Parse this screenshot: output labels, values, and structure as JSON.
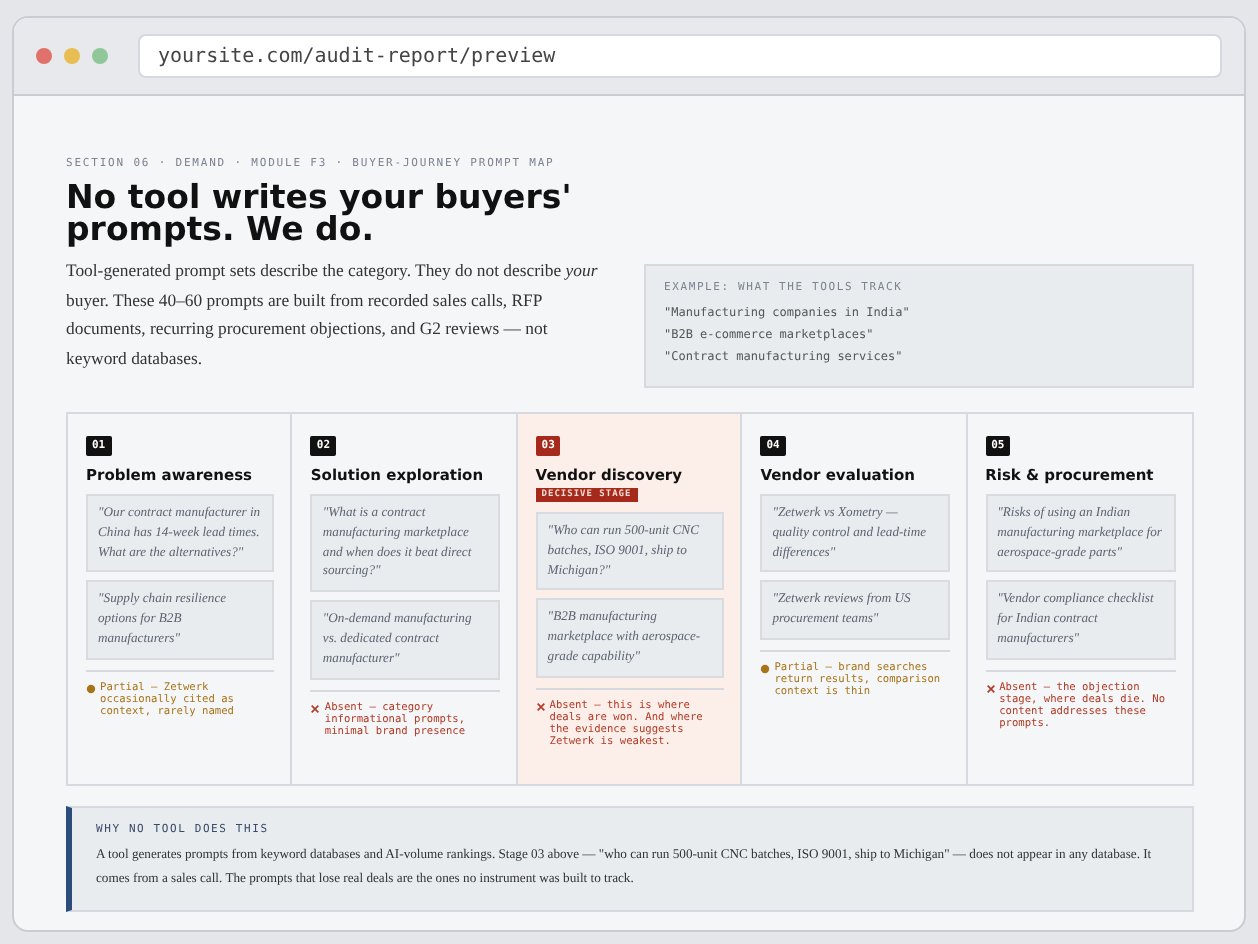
{
  "browser": {
    "url": "yoursite.com/audit-report/preview"
  },
  "eyebrow": "SECTION 06 · DEMAND · MODULE F3 · BUYER-JOURNEY PROMPT MAP",
  "headline": "No tool writes your buyers' prompts. We do.",
  "intro": "Tool-generated prompt sets describe the category. They do not describe *your* buyer. These 40–60 prompts are built from recorded sales calls, RFP documents, recurring procurement objections, and G2 reviews — not keyword databases.",
  "example": {
    "label": "EXAMPLE: WHAT THE TOOLS TRACK",
    "items": [
      "\"Manufacturing companies in India\"",
      "\"B2B e-commerce marketplaces\"",
      "\"Contract manufacturing services\""
    ]
  },
  "stages": [
    {
      "number": "01",
      "title": "Problem awareness",
      "highlighted": false,
      "prompts": [
        "\"Our contract manufacturer in China has 14-week lead times. What are the alternatives?\"",
        "\"Supply chain resilience options for B2B manufacturers\""
      ],
      "status": {
        "kind": "partial",
        "text": "Partial — Zetwerk occasionally cited as context, rarely named"
      }
    },
    {
      "number": "02",
      "title": "Solution exploration",
      "highlighted": false,
      "prompts": [
        "\"What is a contract manufacturing marketplace and when does it beat direct sourcing?\"",
        "\"On-demand manufacturing vs. dedicated contract manufacturer\""
      ],
      "status": {
        "kind": "absent",
        "text": "Absent — category informational prompts, minimal brand presence"
      }
    },
    {
      "number": "03",
      "title": "Vendor discovery",
      "highlighted": true,
      "badge": "DECISIVE STAGE",
      "prompts": [
        "\"Who can run 500-unit CNC batches, ISO 9001, ship to Michigan?\"",
        "\"B2B manufacturing marketplace with aerospace-grade capability\""
      ],
      "status": {
        "kind": "absent",
        "text": "Absent — this is where deals are won. And where the evidence suggests Zetwerk is weakest."
      }
    },
    {
      "number": "04",
      "title": "Vendor evaluation",
      "highlighted": false,
      "prompts": [
        "\"Zetwerk vs Xometry — quality control and lead-time differences\"",
        "\"Zetwerk reviews from US procurement teams\""
      ],
      "status": {
        "kind": "partial",
        "text": "Partial — brand searches return results, comparison context is thin"
      }
    },
    {
      "number": "05",
      "title": "Risk & procurement",
      "highlighted": false,
      "prompts": [
        "\"Risks of using an Indian manufacturing marketplace for aerospace-grade parts\"",
        "\"Vendor compliance checklist for Indian contract manufacturers\""
      ],
      "status": {
        "kind": "absent",
        "text": "Absent — the objection stage, where deals die. No content addresses these prompts."
      }
    }
  ],
  "note": {
    "label": "WHY NO TOOL DOES THIS",
    "text": "A tool generates prompts from keyword databases and AI-volume rankings. Stage 03 above — \"who can run 500-unit CNC batches, ISO 9001, ship to Michigan\" — does not appear in any database. It comes from a sales call. The prompts that lose real deals are the ones no instrument was built to track."
  }
}
